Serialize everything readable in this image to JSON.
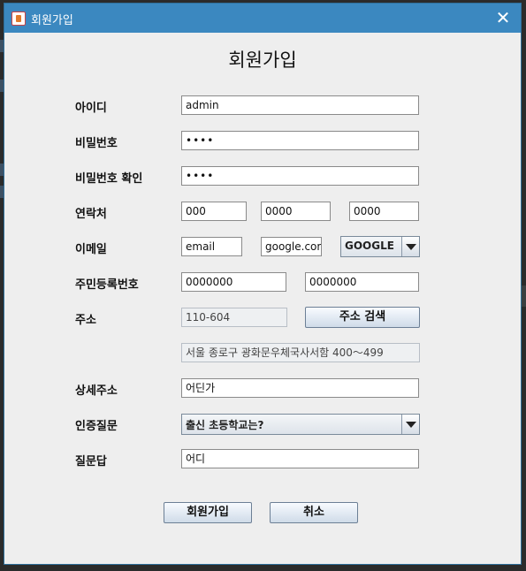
{
  "window": {
    "title": "회원가입",
    "close_glyph": "✕"
  },
  "heading": "회원가입",
  "labels": {
    "id": "아이디",
    "password": "비밀번호",
    "password_confirm": "비밀번호 확인",
    "phone": "연락처",
    "email": "이메일",
    "resident_number": "주민등록번호",
    "address": "주소",
    "detail_address": "상세주소",
    "auth_question": "인증질문",
    "answer": "질문답"
  },
  "fields": {
    "id": "admin",
    "password": "••••",
    "password_confirm": "••••",
    "phone": [
      "000",
      "0000",
      "0000"
    ],
    "email_id": "email",
    "email_domain": "google.com",
    "email_select": "GOOGLE",
    "resident_front": "0000000",
    "resident_back": "0000000",
    "zipcode": "110-604",
    "address_line": "서울 종로구 광화문우체국사서함 400～499",
    "detail_address": "어딘가",
    "auth_question_select": "출신 초등학교는?",
    "answer": "어디"
  },
  "buttons": {
    "address_search": "주소 검색",
    "signup": "회원가입",
    "cancel": "취소"
  },
  "colors": {
    "titlebar": "#3b88c0",
    "window_bg": "#eeeeee",
    "desktop_bg": "#2b2b2b"
  }
}
